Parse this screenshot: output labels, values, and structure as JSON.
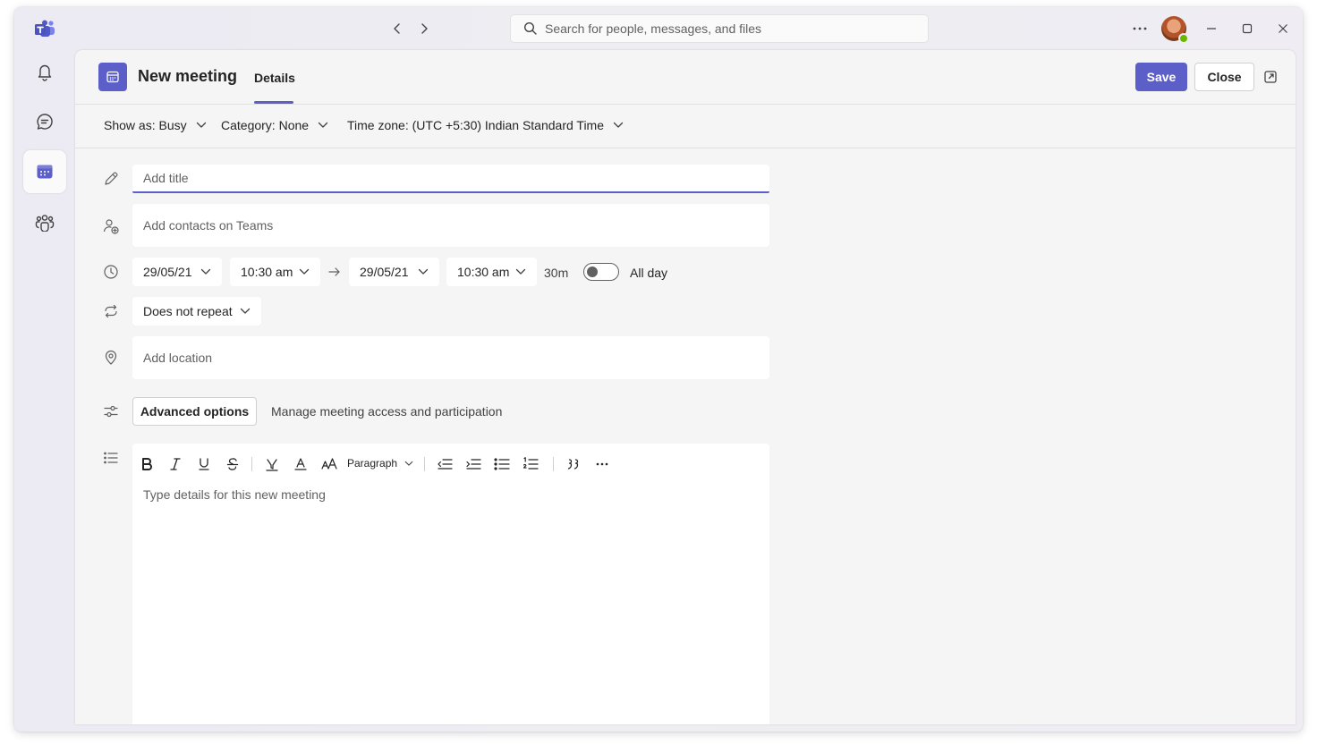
{
  "titlebar": {
    "search_placeholder": "Search for people, messages, and files"
  },
  "header": {
    "title": "New meeting",
    "tab": "Details",
    "save_label": "Save",
    "close_label": "Close"
  },
  "options": {
    "show_as": "Show as: Busy",
    "category": "Category: None",
    "time_zone": "Time zone: (UTC +5:30) Indian Standard Time"
  },
  "form": {
    "title_placeholder": "Add title",
    "attendees_placeholder": "Add contacts on Teams",
    "start_date": "29/05/21",
    "start_time": "10:30 am",
    "end_date": "29/05/21",
    "end_time": "10:30 am",
    "duration": "30m",
    "all_day_label": "All day",
    "all_day_on": false,
    "repeat": "Does not repeat",
    "location_placeholder": "Add location",
    "advanced_label": "Advanced options",
    "advanced_desc": "Manage meeting access and participation",
    "paragraph_style": "Paragraph",
    "details_placeholder": "Type details for this new meeting"
  },
  "colors": {
    "accent": "#5b5fc7",
    "presence_available": "#6bb700"
  }
}
